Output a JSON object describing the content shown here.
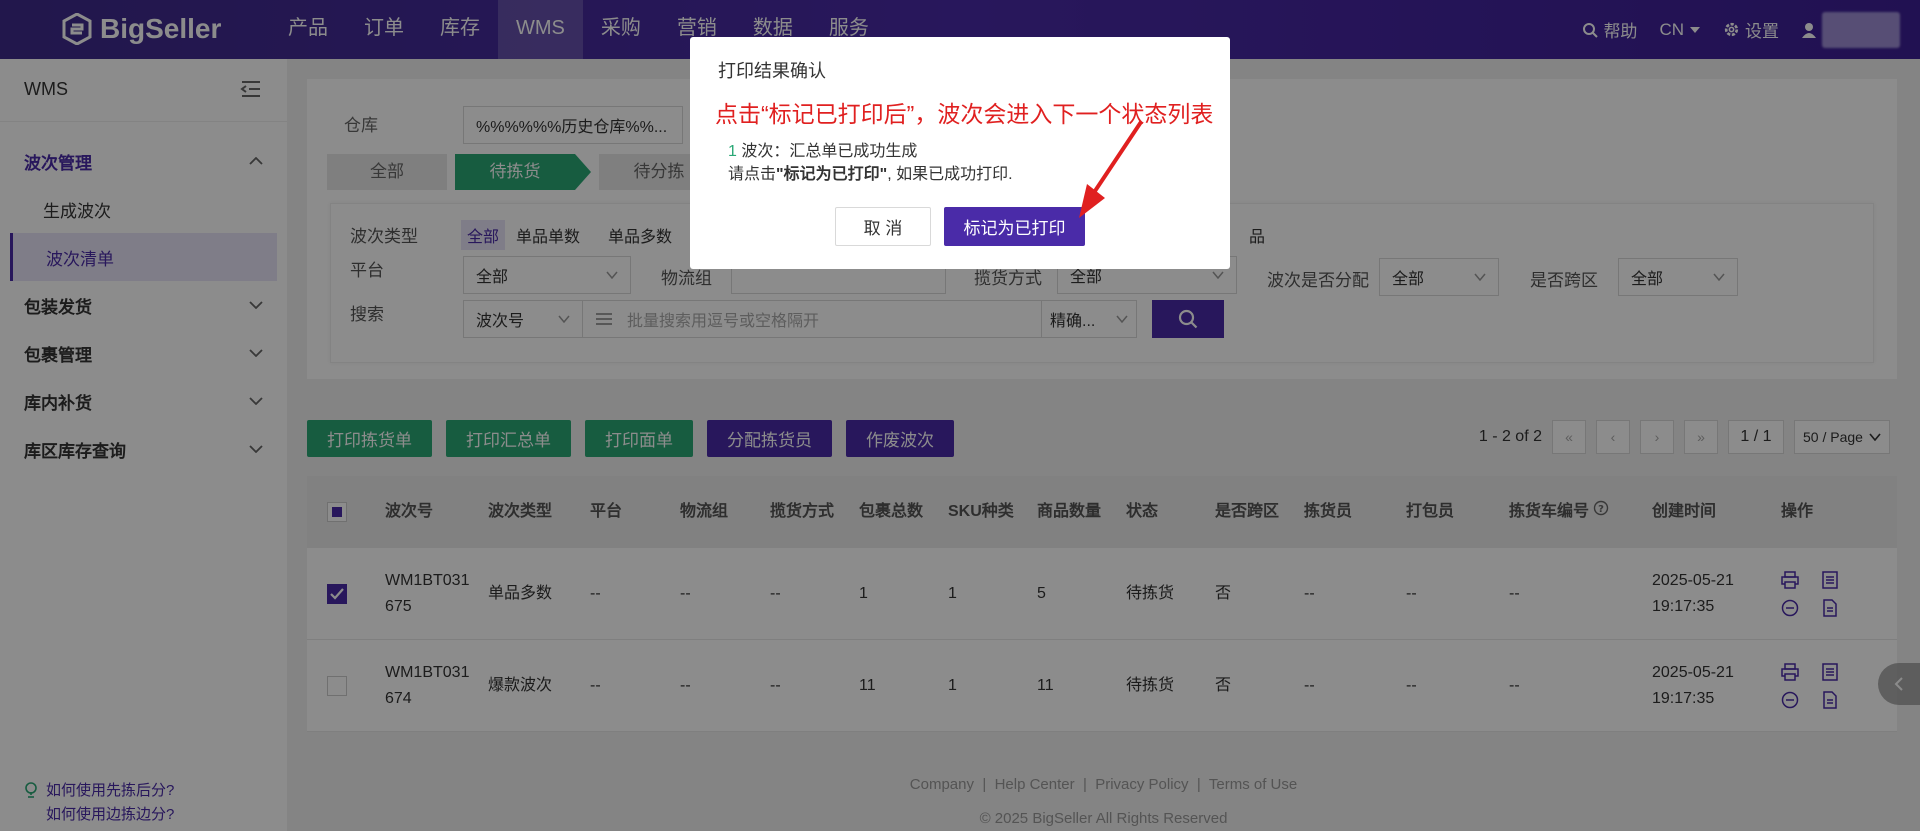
{
  "brand": {
    "name": "BigSeller"
  },
  "nav": {
    "items": [
      "产品",
      "订单",
      "库存",
      "WMS",
      "采购",
      "营销",
      "数据",
      "服务"
    ],
    "active_index": 3
  },
  "top_right": {
    "help": "帮助",
    "lang": "CN",
    "settings": "设置"
  },
  "sidebar": {
    "title": "WMS",
    "groups": [
      {
        "label": "波次管理",
        "open": true,
        "subs": [
          "生成波次",
          "波次清单"
        ],
        "active_sub": 1
      },
      {
        "label": "包装发货"
      },
      {
        "label": "包裹管理"
      },
      {
        "label": "库内补货"
      },
      {
        "label": "库区库存查询"
      }
    ],
    "help_links": [
      "如何使用先拣后分?",
      "如何使用边拣边分?"
    ]
  },
  "filters": {
    "warehouse_label": "仓库",
    "warehouse_value": "%%%%%%历史仓库%%...",
    "tabs": [
      "全部",
      "待拣货",
      "待分拣"
    ],
    "active_tab": 1,
    "wave_type_label": "波次类型",
    "wave_types": [
      "全部",
      "单品单数",
      "单品多数"
    ],
    "wave_type_extra": "品",
    "platform_label": "平台",
    "platform_value": "全部",
    "logistics_label": "物流组",
    "pickup_label": "揽货方式",
    "pickup_value": "全部",
    "allocated_label": "波次是否分配",
    "allocated_value": "全部",
    "cross_zone_label": "是否跨区",
    "cross_zone_value": "全部",
    "search_label": "搜索",
    "search_field": "波次号",
    "search_placeholder": "批量搜索用逗号或空格隔开",
    "match_mode": "精确..."
  },
  "actions": [
    "打印拣货单",
    "打印汇总单",
    "打印面单",
    "分配拣货员",
    "作废波次"
  ],
  "pager": {
    "summary": "1 - 2 of 2",
    "page": "1 / 1",
    "size": "50 / Page"
  },
  "table": {
    "headers": [
      "波次号",
      "波次类型",
      "平台",
      "物流组",
      "揽货方式",
      "包裹总数",
      "SKU种类",
      "商品数量",
      "状态",
      "是否跨区",
      "拣货员",
      "打包员",
      "拣货车编号",
      "创建时间",
      "操作"
    ],
    "rows": [
      {
        "checked": true,
        "wave_no": "WM1BT031675",
        "type": "单品多数",
        "platform": "--",
        "logistics": "--",
        "pickup": "--",
        "packages": "1",
        "sku": "1",
        "qty": "5",
        "status": "待拣货",
        "cross": "否",
        "picker": "--",
        "packer": "--",
        "cart": "--",
        "created": "2025-05-21 19:17:35"
      },
      {
        "checked": false,
        "wave_no": "WM1BT031674",
        "type": "爆款波次",
        "platform": "--",
        "logistics": "--",
        "pickup": "--",
        "packages": "11",
        "sku": "1",
        "qty": "11",
        "status": "待拣货",
        "cross": "否",
        "picker": "--",
        "packer": "--",
        "cart": "--",
        "created": "2025-05-21 19:17:35"
      }
    ]
  },
  "footer": {
    "links": [
      "Company",
      "Help Center",
      "Privacy Policy",
      "Terms of Use"
    ],
    "copyright": "© 2025 BigSeller All Rights Reserved"
  },
  "modal": {
    "title": "打印结果确认",
    "annotation": "点击“标记已打印后”，波次会进入下一个状态列表",
    "count": "1",
    "line1_rest": " 波次：汇总单已成功生成",
    "line2_prefix": "请点击",
    "line2_bold": "\"标记为已打印\"",
    "line2_suffix": ", 如果已成功打印.",
    "cancel": "取 消",
    "confirm": "标记为已打印"
  },
  "colors": {
    "brand": "#4a2ba8",
    "green": "#2aa876",
    "annotation": "#e02020"
  }
}
